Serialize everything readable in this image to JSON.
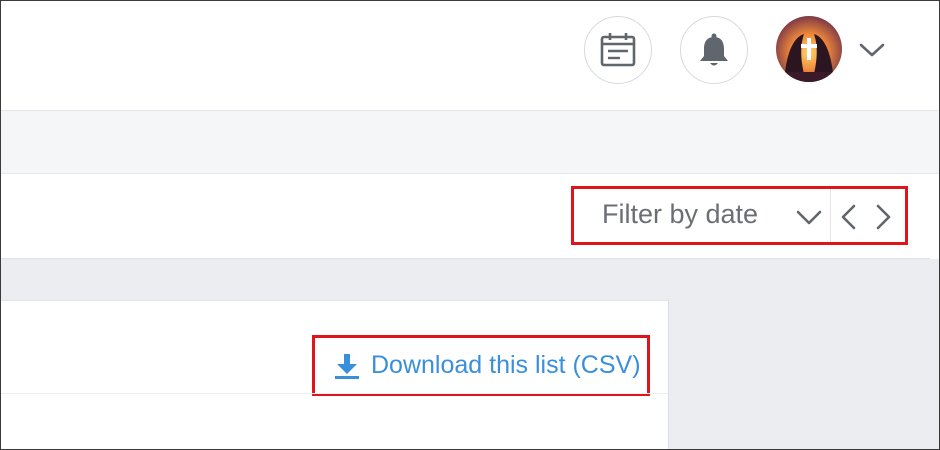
{
  "header": {
    "calendar_icon": "calendar-icon",
    "bell_icon": "bell-icon",
    "avatar": "user-avatar",
    "menu_icon": "chevron-down-icon"
  },
  "filter": {
    "label": "Filter by date",
    "dropdown_icon": "chevron-down-icon",
    "prev_icon": "chevron-left-icon",
    "next_icon": "chevron-right-icon"
  },
  "list": {
    "download_label": "Download this list (CSV)",
    "download_icon": "download-icon"
  },
  "colors": {
    "highlight": "#e0151b",
    "link": "#3a8fdc",
    "icon_gray": "#5f666d"
  }
}
